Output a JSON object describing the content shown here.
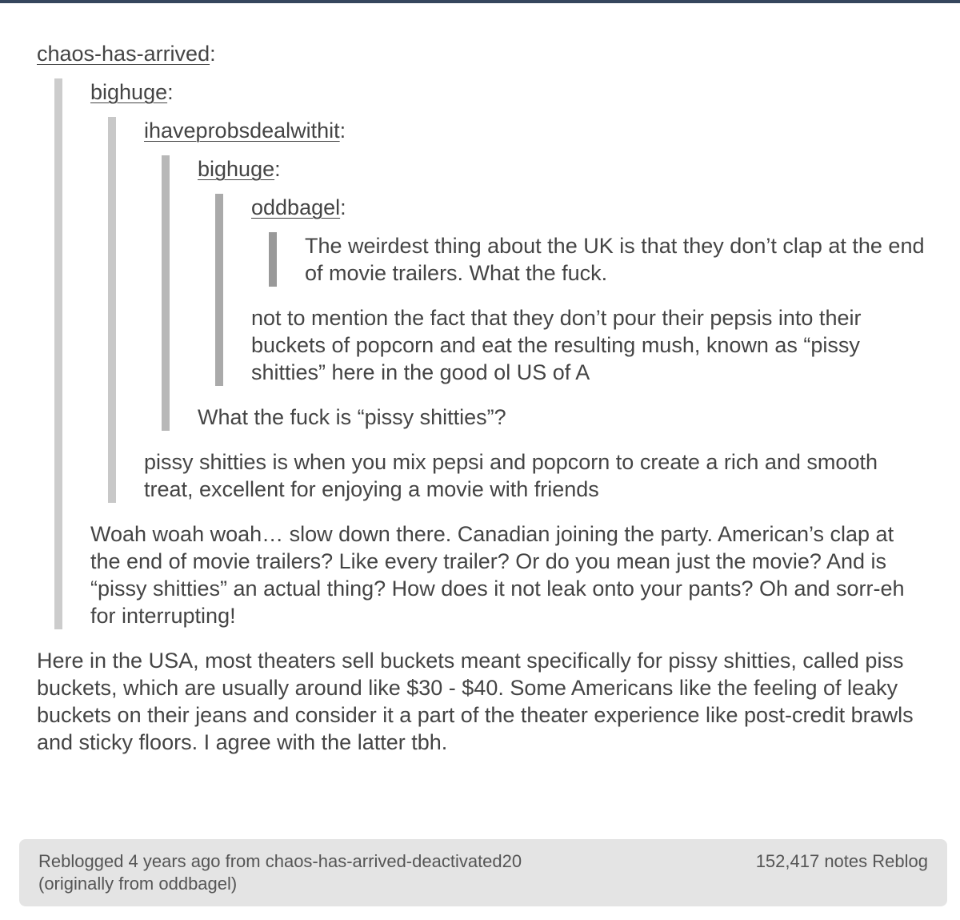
{
  "chain": {
    "level0_user": "chaos-has-arrived",
    "level1_user": "bighuge",
    "level2_user": "ihaveprobsdealwithit",
    "level3_user": "bighuge",
    "level4_user": "oddbagel",
    "colon": ":",
    "oddbagel_text": "The weirdest thing about the UK is that they don’t clap at the end of movie trailers. What the fuck.",
    "bighuge_text_1": "not to mention the fact that they don’t pour their pepsis into their buckets of popcorn and eat the resulting mush, known as “pissy shitties” here in the good ol US of A",
    "ihaveprobsdealwithit_text": "What the fuck is “pissy shitties”?",
    "bighuge_text_2": "pissy shitties is when you mix pepsi and popcorn to create a rich and smooth treat, excellent for enjoying a movie with friends",
    "chaos_has_arrived_text": "Woah woah woah… slow down there. Canadian joining the party. American’s clap at the end of movie trailers? Like every trailer? Or do you mean just the movie? And is “pissy shitties” an actual thing? How does it not leak onto your pants? Oh and sorr-eh for interrupting!",
    "final_text": "Here in the USA, most theaters sell buckets meant specifically for pissy shitties, called piss buckets, which are usually around like $30 - $40. Some Americans like the feeling of leaky buckets on their jeans and consider it a part of the theater experience like post-credit brawls and sticky floors. I agree with the latter tbh."
  },
  "footer": {
    "reblog_info": "Reblogged 4 years ago from chaos-has-arrived-deactivated20",
    "original_info": "(originally from oddbagel)",
    "notes": "152,417 notes",
    "reblog_label": "Reblog"
  },
  "colors": {
    "top_bar": "#36465d",
    "footer_bg": "#e4e4e4",
    "text": "#444444"
  }
}
